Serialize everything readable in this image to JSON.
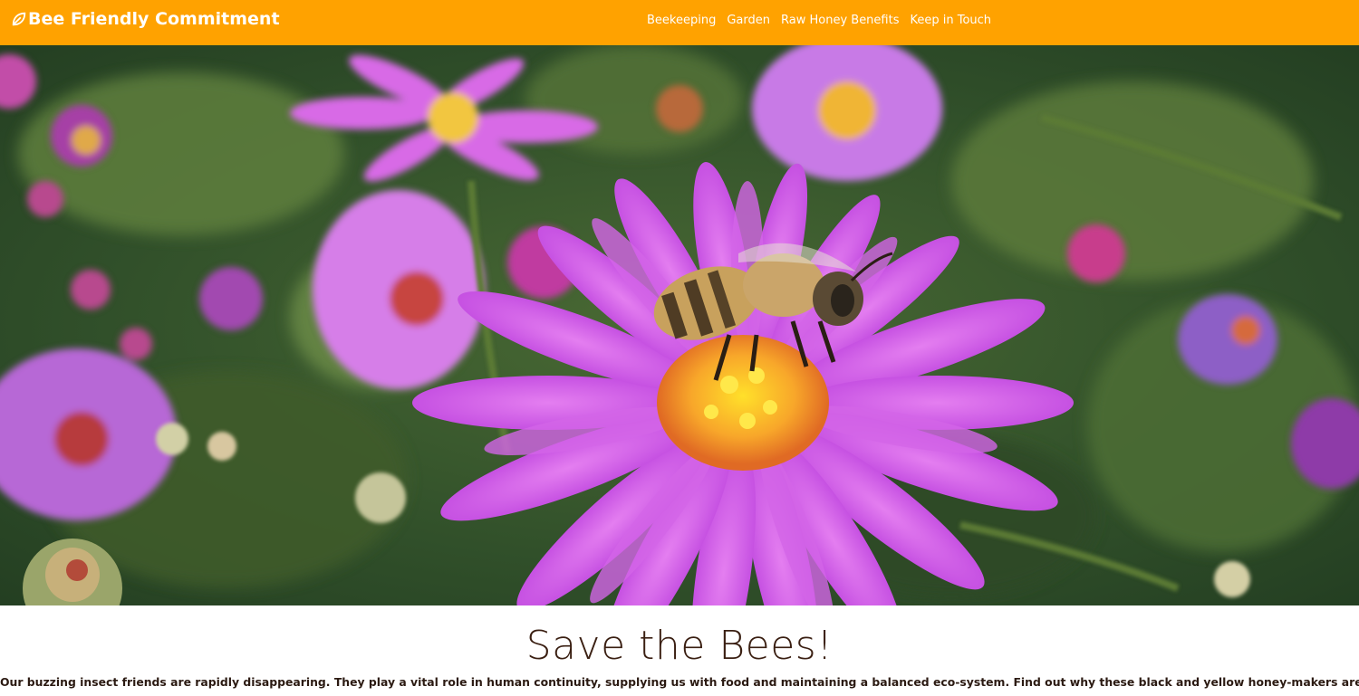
{
  "brand": {
    "name": "Bee Friendly Commitment",
    "icon": "leaf-icon"
  },
  "nav": {
    "items": [
      {
        "label": "Beekeeping"
      },
      {
        "label": "Garden"
      },
      {
        "label": "Raw Honey Benefits"
      },
      {
        "label": "Keep in Touch"
      }
    ]
  },
  "hero": {
    "image": "bee-on-purple-aster-flower"
  },
  "main": {
    "title": "Save the Bees!",
    "lead": "Our buzzing insect friends are rapidly disappearing. They play a vital role in human continuity, supplying us with food and maintaining a balanced eco-system. Find out why these black and yellow honey-makers are so very important and what"
  },
  "colors": {
    "navbar": "#ffa200",
    "title": "#3a1f12",
    "text": "#2b1a12"
  }
}
